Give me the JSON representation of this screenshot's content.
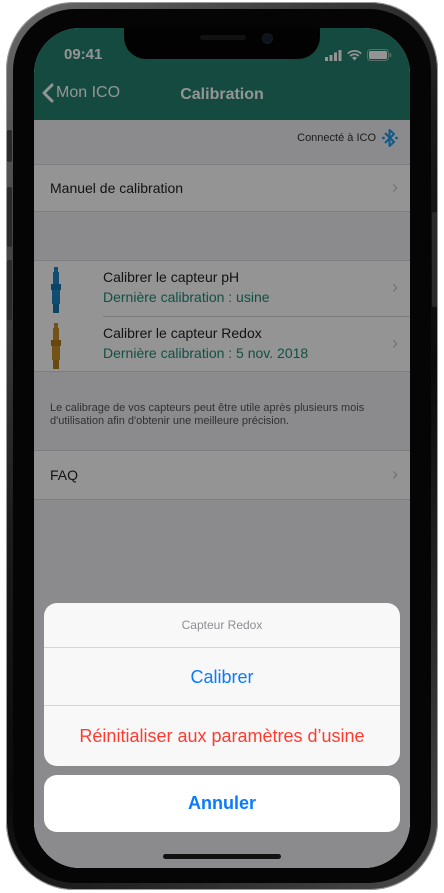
{
  "status_bar": {
    "time": "09:41"
  },
  "nav": {
    "back_label": "Mon ICO",
    "title": "Calibration"
  },
  "connection": {
    "label": "Connecté à ICO"
  },
  "rows": {
    "manual": "Manuel de calibration",
    "faq": "FAQ"
  },
  "sensors": [
    {
      "title": "Calibrer le capteur pH",
      "subtitle": "Dernière calibration : usine",
      "color": "#1a87c4",
      "icon": "ph-probe-icon"
    },
    {
      "title": "Calibrer le capteur Redox",
      "subtitle": "Dernière calibration : 5 nov. 2018",
      "color": "#c99227",
      "icon": "redox-probe-icon"
    }
  ],
  "footnote": "Le calibrage de vos capteurs peut être utile après plusieurs mois d'utilisation afin d'obtenir une meilleure précision.",
  "action_sheet": {
    "title": "Capteur Redox",
    "calibrate": "Calibrer",
    "reset": "Réinitialiser aux paramètres d’usine",
    "cancel": "Annuler"
  },
  "colors": {
    "brand": "#24806f",
    "action_blue": "#0a7aff",
    "destructive_red": "#ff3b30",
    "accent_teal": "#1f8a74"
  }
}
